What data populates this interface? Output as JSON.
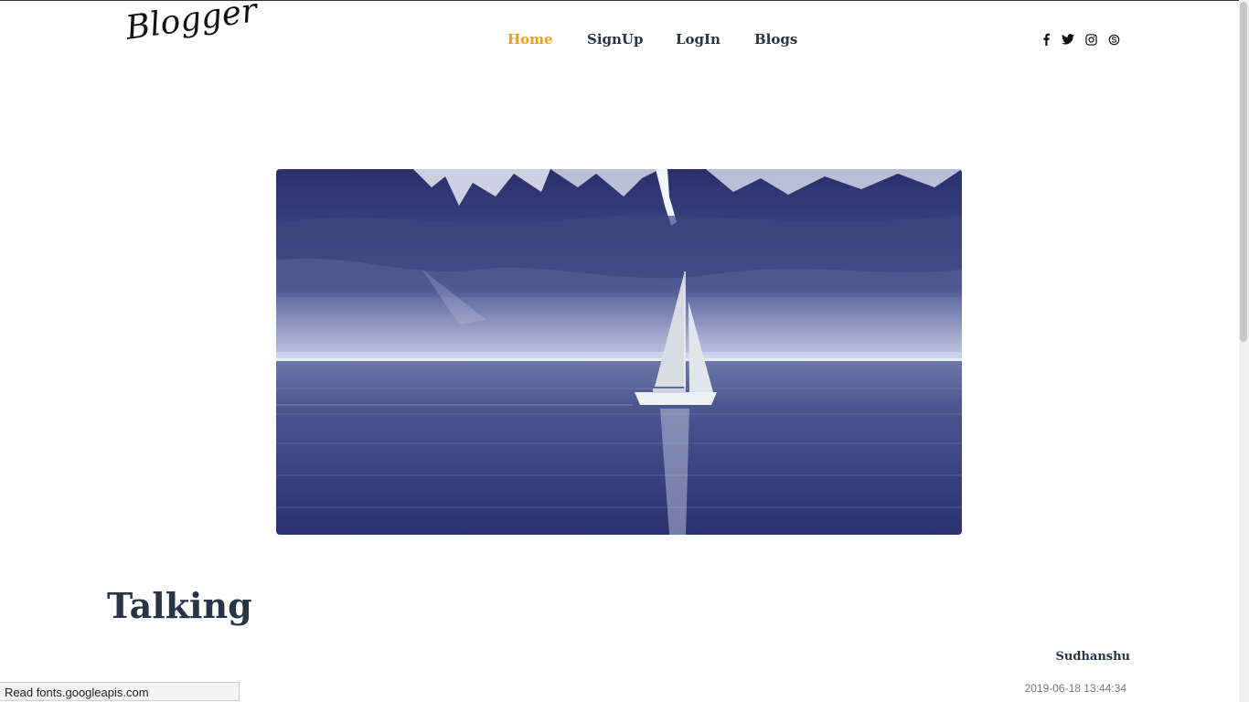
{
  "header": {
    "logo_text": "Blogger",
    "nav": [
      {
        "label": "Home",
        "active": true
      },
      {
        "label": "SignUp",
        "active": false
      },
      {
        "label": "LogIn",
        "active": false
      },
      {
        "label": "Blogs",
        "active": false
      }
    ],
    "social_icons": [
      "facebook-icon",
      "twitter-icon",
      "instagram-icon",
      "skype-icon"
    ]
  },
  "post": {
    "image_alt": "sailboat on lake with mountains",
    "title": "Talking",
    "author": "Sudhanshu",
    "date": "2019-06-18 13:44:34"
  },
  "status_bar": {
    "text": "Read fonts.googleapis.com"
  },
  "colors": {
    "accent": "#f0a020",
    "text": "#2b3444"
  }
}
